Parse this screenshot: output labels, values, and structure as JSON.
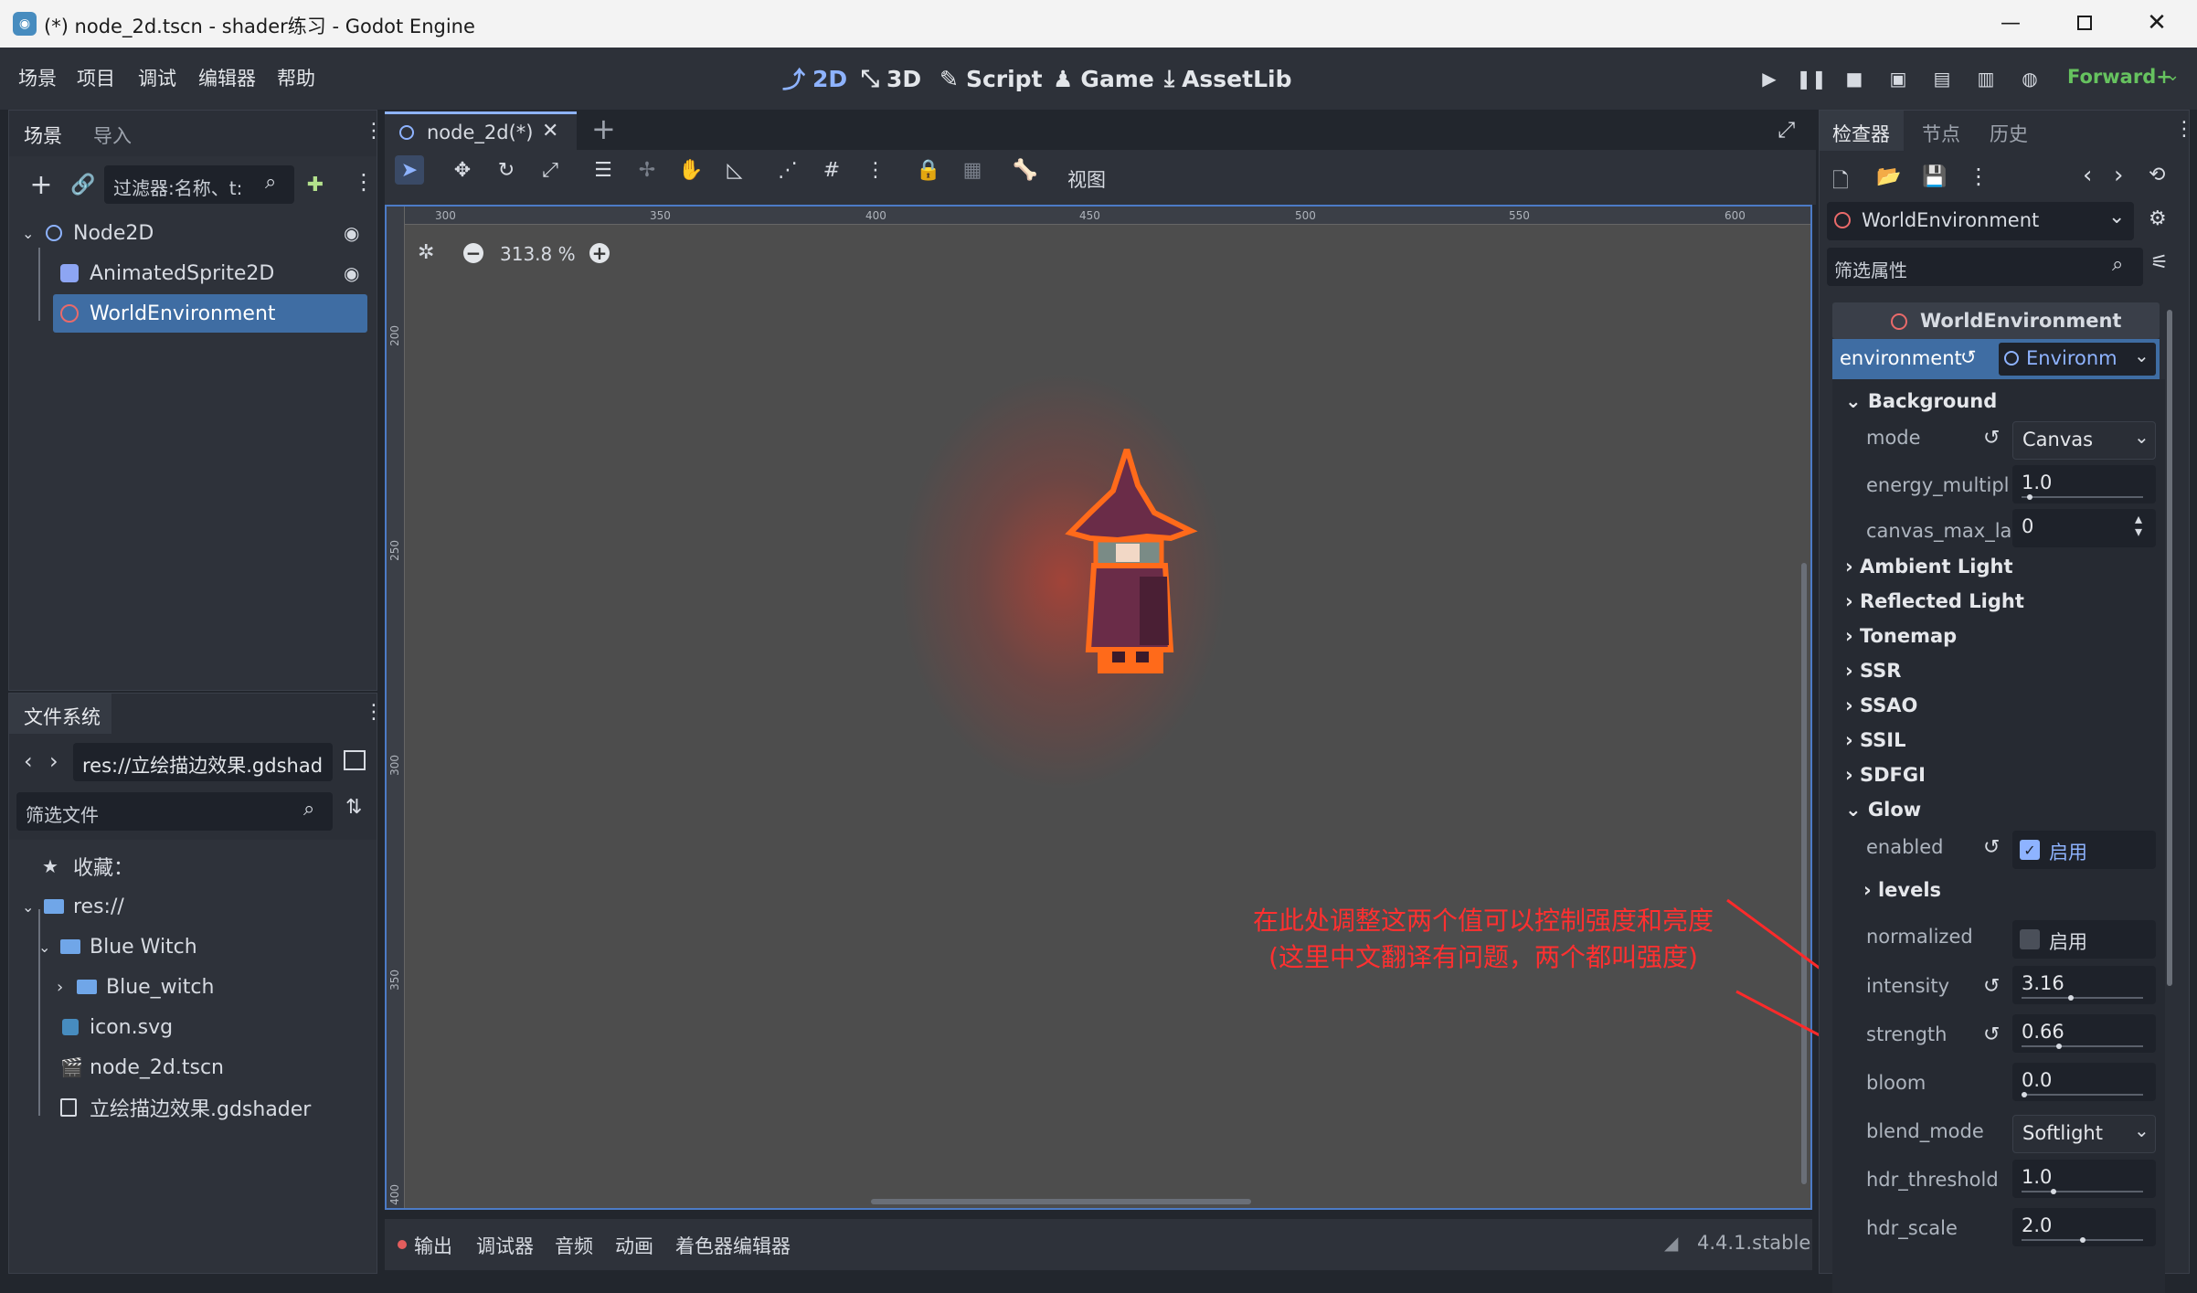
{
  "window": {
    "title": "(*) node_2d.tscn - shader练习 - Godot Engine"
  },
  "menu": [
    "场景",
    "项目",
    "调试",
    "编辑器",
    "帮助"
  ],
  "workspaces": [
    "2D",
    "3D",
    "Script",
    "Game",
    "AssetLib"
  ],
  "renderer": "Forward+",
  "scene_panel": {
    "tabs": [
      "场景",
      "导入"
    ],
    "filter_placeholder": "过滤器:名称、t:",
    "nodes": [
      "Node2D",
      "AnimatedSprite2D",
      "WorldEnvironment"
    ]
  },
  "filesystem": {
    "tab": "文件系统",
    "path": "res://立绘描边效果.gdshad",
    "filter_placeholder": "筛选文件",
    "items": [
      "收藏：",
      "res://",
      "Blue Witch",
      "Blue_witch",
      "icon.svg",
      "node_2d.tscn",
      "立绘描边效果.gdshader"
    ]
  },
  "editor": {
    "tab_label": "node_2d(*)",
    "view_menu": "视图",
    "zoom": "313.8 %",
    "ruler_h": [
      "300",
      "350",
      "400",
      "450",
      "500",
      "550",
      "600"
    ],
    "ruler_v": [
      "200",
      "250",
      "300",
      "350",
      "400"
    ],
    "annotation_line1": "在此处调整这两个值可以控制强度和亮度",
    "annotation_line2": "(这里中文翻译有问题，两个都叫强度)"
  },
  "bottom_bar": {
    "tabs": [
      "输出",
      "调试器",
      "音频",
      "动画",
      "着色器编辑器"
    ],
    "version": "4.4.1.stable"
  },
  "inspector": {
    "tabs": [
      "检查器",
      "节点",
      "历史"
    ],
    "node_select": "WorldEnvironment",
    "filter_placeholder": "筛选属性",
    "header": "WorldEnvironment",
    "env_label": "environment",
    "env_value": "Environm",
    "sections": {
      "background": "Background",
      "ambient": "Ambient Light",
      "reflected": "Reflected Light",
      "tonemap": "Tonemap",
      "ssr": "SSR",
      "ssao": "SSAO",
      "ssil": "SSIL",
      "sdfgi": "SDFGI",
      "glow": "Glow",
      "levels": "levels"
    },
    "props": {
      "mode": {
        "label": "mode",
        "value": "Canvas"
      },
      "energy": {
        "label": "energy_multipl",
        "value": "1.0",
        "fill": 0.05
      },
      "canvas_max": {
        "label": "canvas_max_la",
        "value": "0"
      },
      "enabled": {
        "label": "enabled",
        "value": "启用",
        "checked": true
      },
      "normalized": {
        "label": "normalized",
        "value": "启用",
        "checked": false
      },
      "intensity": {
        "label": "intensity",
        "value": "3.16",
        "fill": 0.4
      },
      "strength": {
        "label": "strength",
        "value": "0.66",
        "fill": 0.3
      },
      "bloom": {
        "label": "bloom",
        "value": "0.0",
        "fill": 0.0
      },
      "blend_mode": {
        "label": "blend_mode",
        "value": "Softlight"
      },
      "hdr_threshold": {
        "label": "hdr_threshold",
        "value": "1.0",
        "fill": 0.25
      },
      "hdr_scale": {
        "label": "hdr_scale",
        "value": "2.0",
        "fill": 0.5
      }
    }
  },
  "colors": {
    "accent": "#8eb3ff",
    "selection": "#3f6da3",
    "annotation": "#ff2a2a",
    "canvas": "#4d4d4d"
  }
}
